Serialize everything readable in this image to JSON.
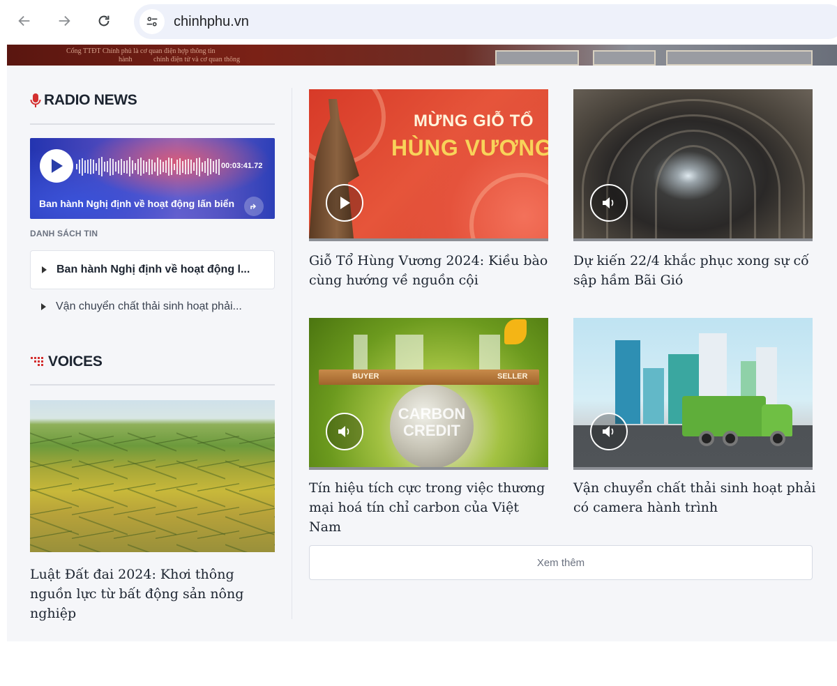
{
  "browser": {
    "url": "chinhphu.vn"
  },
  "banner": {
    "line1": "Cổng TTĐT Chính phủ là cơ quan điện hợp thông tin",
    "line2": "hành",
    "line3": "chính điện tử và cơ quan thông"
  },
  "radio": {
    "title": "RADIO NEWS",
    "player": {
      "time": "00:03:41.72",
      "title": "Ban hành Nghị định về hoạt động lấn biển"
    },
    "list_label": "DANH SÁCH TIN",
    "items": [
      {
        "label": "Ban hành Nghị định về hoạt động l..."
      },
      {
        "label": "Vận chuyển chất thải sinh hoạt phải..."
      }
    ]
  },
  "voices": {
    "title": "VOICES",
    "caption": "Luật Đất đai 2024: Khơi thông nguồn lực từ bất động sản nông nghiệp"
  },
  "cards": [
    {
      "title": "Giỗ Tổ Hùng Vương 2024: Kiều bào cùng hướng về nguồn cội",
      "media": "video",
      "image_text_1": "MỪNG GIỖ TỔ",
      "image_text_2": "HÙNG VƯƠNG"
    },
    {
      "title": "Dự kiến 22/4 khắc phục xong sự cố sập hầm Bãi Gió",
      "media": "audio"
    },
    {
      "title": "Tín hiệu tích cực trong việc thương mại hoá tín chỉ carbon của Việt Nam",
      "media": "audio",
      "image_text_buyer": "BUYER",
      "image_text_seller": "SELLER",
      "image_text_globe": "CARBON CREDIT"
    },
    {
      "title": "Vận chuyển chất thải sinh hoạt phải có camera hành trình",
      "media": "audio"
    }
  ],
  "more_button": "Xem thêm",
  "colors": {
    "accent_red": "#d32f2f",
    "text_dark": "#1c2430",
    "page_bg": "#f5f6f9"
  }
}
